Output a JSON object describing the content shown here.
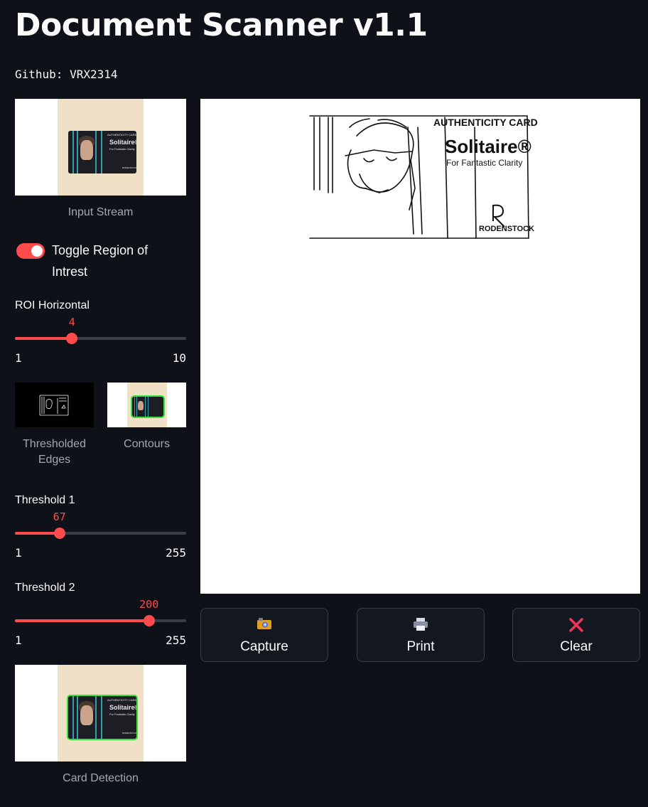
{
  "app": {
    "title": "Document Scanner v1.1",
    "github": "Github: VRX2314"
  },
  "sidebar": {
    "input_stream_caption": "Input Stream",
    "toggle": {
      "label": "Toggle Region of Intrest",
      "checked": true
    },
    "roi_slider": {
      "label": "ROI Horizontal",
      "value": "4",
      "min": "1",
      "max": "10",
      "fraction": 0.333
    },
    "thresholded_caption": "Thresholded Edges",
    "contours_caption": "Contours",
    "threshold1": {
      "label": "Threshold 1",
      "value": "67",
      "min": "1",
      "max": "255",
      "fraction": 0.26
    },
    "threshold2": {
      "label": "Threshold 2",
      "value": "200",
      "min": "1",
      "max": "255",
      "fraction": 0.783
    },
    "card_detection_caption": "Card Detection"
  },
  "card_image": {
    "header": "AUTHENTICITY CARD",
    "brand": "Solitaire®",
    "tagline": "For Fantastic Clarity",
    "maker": "RODENSTOCK"
  },
  "buttons": {
    "capture": {
      "label": "Capture",
      "icon": "camera-icon"
    },
    "print": {
      "label": "Print",
      "icon": "printer-icon"
    },
    "clear": {
      "label": "Clear",
      "icon": "close-icon"
    }
  },
  "colors": {
    "accent": "#ff4b4b",
    "background": "#0e1117",
    "contour": "#35e23a"
  }
}
